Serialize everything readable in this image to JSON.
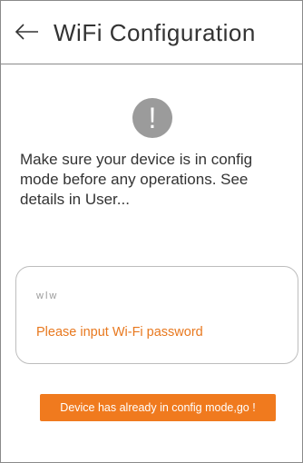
{
  "header": {
    "back_icon": "arrow-left-icon",
    "title": "WiFi  Configuration"
  },
  "notice": {
    "icon": "exclamation-circle-icon",
    "icon_glyph": "!",
    "text": "Make sure your device is in config mode before any operations. See details in User..."
  },
  "wifi_form": {
    "ssid": "wlw",
    "password_value": "",
    "password_placeholder": "Please input Wi-Fi password"
  },
  "action": {
    "confirm_label": "Device has already in config mode,go !"
  },
  "colors": {
    "accent": "#f07a1e",
    "placeholder": "#e8781e",
    "icon_gray": "#9b9b9b",
    "border": "#8a8a8a"
  }
}
